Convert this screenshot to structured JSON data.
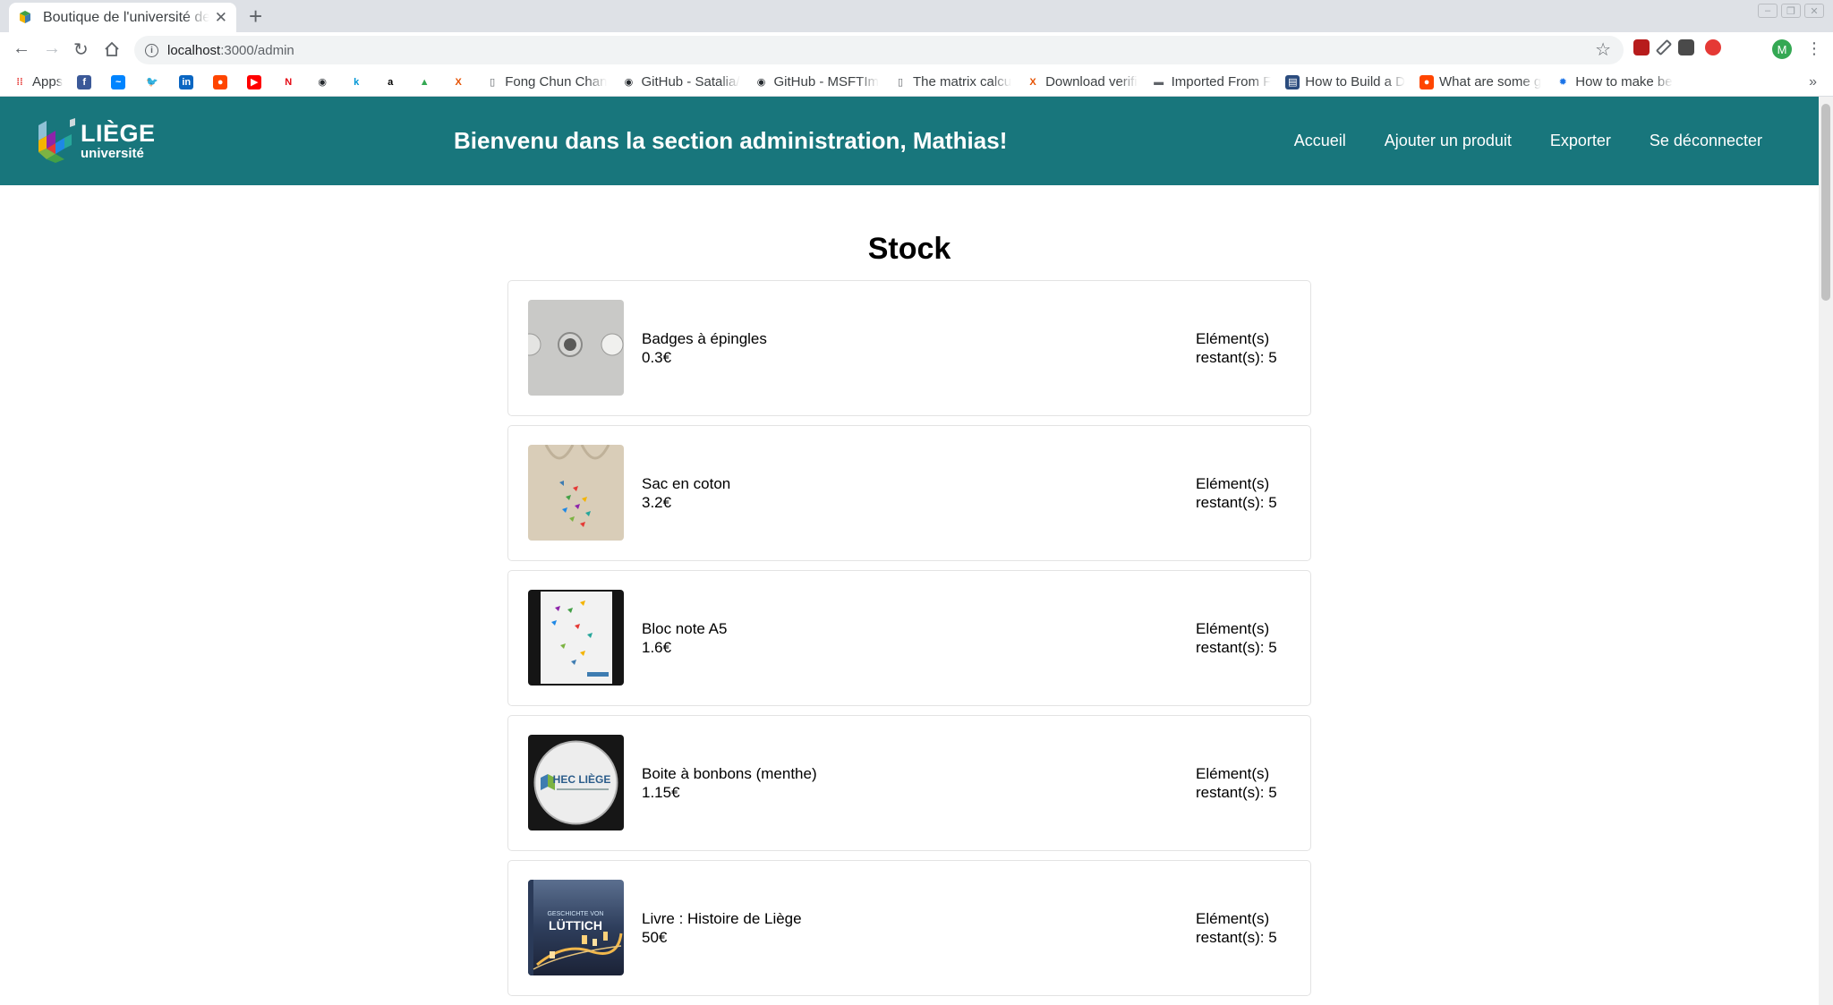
{
  "browser": {
    "tab_title": "Boutique de l'université de Liège",
    "url_host": "localhost",
    "url_path": ":3000/admin",
    "bookmarks": [
      {
        "icon": "apps-grid-icon",
        "label": "Apps"
      },
      {
        "icon": "facebook-icon",
        "label": ""
      },
      {
        "icon": "messenger-icon",
        "label": ""
      },
      {
        "icon": "twitter-icon",
        "label": ""
      },
      {
        "icon": "linkedin-icon",
        "label": ""
      },
      {
        "icon": "reddit-icon",
        "label": ""
      },
      {
        "icon": "youtube-icon",
        "label": ""
      },
      {
        "icon": "netflix-icon",
        "label": ""
      },
      {
        "icon": "github-icon",
        "label": ""
      },
      {
        "icon": "k-icon",
        "label": ""
      },
      {
        "icon": "amazon-icon",
        "label": ""
      },
      {
        "icon": "drive-icon",
        "label": ""
      },
      {
        "icon": "x-icon",
        "label": ""
      },
      {
        "icon": "page-icon",
        "label": "Fong Chun Chan"
      },
      {
        "icon": "github-icon",
        "label": "GitHub - Satalia/"
      },
      {
        "icon": "github-icon",
        "label": "GitHub - MSFTIm"
      },
      {
        "icon": "page-icon",
        "label": "The matrix calcu"
      },
      {
        "icon": "x-icon",
        "label": "Download verifi"
      },
      {
        "icon": "folder-icon",
        "label": "Imported From F"
      },
      {
        "icon": "bookmark-icon",
        "label": "How to Build a D"
      },
      {
        "icon": "reddit-icon",
        "label": "What are some g"
      },
      {
        "icon": "gear-icon",
        "label": "How to make be"
      }
    ],
    "avatar_letter": "M"
  },
  "header": {
    "logo_main": "LIÈGE",
    "logo_sub": "université",
    "welcome": "Bienvenu dans la section administration, Mathias!",
    "nav": [
      "Accueil",
      "Ajouter un produit",
      "Exporter",
      "Se déconnecter"
    ]
  },
  "main": {
    "title": "Stock",
    "products": [
      {
        "name": "Badges à épingles",
        "price": "0.3€",
        "stock_line1": "Elément(s)",
        "stock_line2": "restant(s): 5"
      },
      {
        "name": "Sac en coton",
        "price": "3.2€",
        "stock_line1": "Elément(s)",
        "stock_line2": "restant(s): 5"
      },
      {
        "name": "Bloc note A5",
        "price": "1.6€",
        "stock_line1": "Elément(s)",
        "stock_line2": "restant(s): 5"
      },
      {
        "name": "Boite à bonbons (menthe)",
        "price": "1.15€",
        "stock_line1": "Elément(s)",
        "stock_line2": "restant(s): 5"
      },
      {
        "name": "Livre : Histoire de Liège",
        "price": "50€",
        "stock_line1": "Elément(s)",
        "stock_line2": "restant(s): 5"
      }
    ],
    "thumb_labels": {
      "mints": "HEC LIÈGE",
      "book_line1": "GESCHICHTE VON",
      "book_line2": "LÜTTICH"
    }
  },
  "colors": {
    "header_bg": "#18767c",
    "card_border": "#e3e3e3"
  }
}
